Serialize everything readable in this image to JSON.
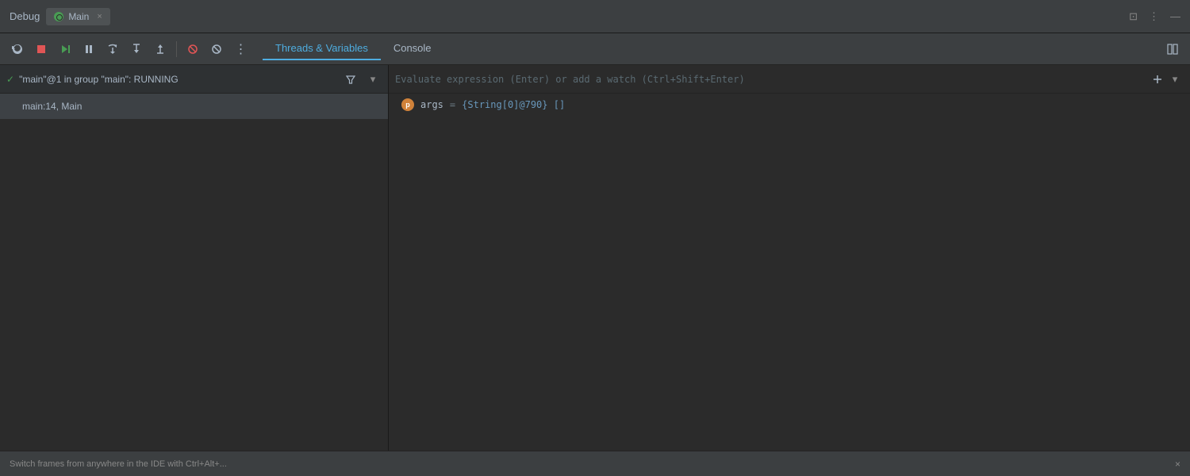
{
  "titlebar": {
    "debug_label": "Debug",
    "tab_label": "Main",
    "close_tab": "×",
    "right_icons": [
      "⊡",
      "⋮",
      "—"
    ]
  },
  "toolbar": {
    "buttons": [
      {
        "id": "restart",
        "symbol": "↻",
        "color": "normal"
      },
      {
        "id": "stop",
        "symbol": "■",
        "color": "red"
      },
      {
        "id": "resume",
        "symbol": "▶|",
        "color": "green"
      },
      {
        "id": "pause",
        "symbol": "⏸",
        "color": "normal"
      },
      {
        "id": "step-over",
        "symbol": "↷",
        "color": "normal"
      },
      {
        "id": "step-into",
        "symbol": "↓",
        "color": "normal"
      },
      {
        "id": "step-out",
        "symbol": "↑",
        "color": "normal"
      },
      {
        "id": "break-stop",
        "symbol": "⊘",
        "color": "red"
      },
      {
        "id": "mute",
        "symbol": "⊘",
        "color": "normal"
      },
      {
        "id": "more",
        "symbol": "⋮",
        "color": "normal"
      }
    ],
    "tabs": [
      {
        "id": "threads-variables",
        "label": "Threads & Variables",
        "active": true
      },
      {
        "id": "console",
        "label": "Console",
        "active": false
      }
    ]
  },
  "threads_panel": {
    "thread": {
      "check_icon": "✓",
      "name": "\"main\"@1 in group \"main\": RUNNING",
      "filter_icon": "⊞",
      "expand_icon": "▾"
    },
    "frame": {
      "label": "main:14, Main"
    }
  },
  "variables_panel": {
    "expression_placeholder": "Evaluate expression (Enter) or add a watch (Ctrl+Shift+Enter)",
    "add_watch_icon": "⊞",
    "expand_icon": "▾",
    "variables": [
      {
        "icon": "p",
        "name": "args",
        "equals": "=",
        "value": "{String[0]@790} []"
      }
    ]
  },
  "status_bar": {
    "message": "Switch frames from anywhere in the IDE with Ctrl+Alt+...",
    "close": "×"
  }
}
